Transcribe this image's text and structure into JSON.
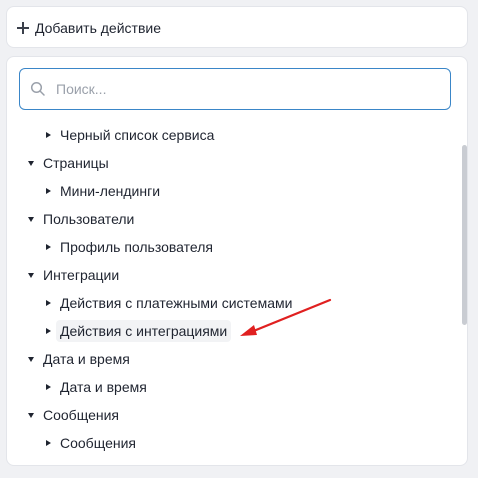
{
  "add_action": {
    "label": "Добавить действие"
  },
  "search": {
    "placeholder": "Поиск..."
  },
  "tree": [
    {
      "kind": "child",
      "label": "Черный список сервиса"
    },
    {
      "kind": "group",
      "label": "Страницы"
    },
    {
      "kind": "child",
      "label": "Мини-лендинги"
    },
    {
      "kind": "group",
      "label": "Пользователи"
    },
    {
      "kind": "child",
      "label": "Профиль пользователя"
    },
    {
      "kind": "group",
      "label": "Интеграции"
    },
    {
      "kind": "child",
      "label": "Действия с платежными системами"
    },
    {
      "kind": "child",
      "label": "Действия с интеграциями",
      "highlight": true
    },
    {
      "kind": "group",
      "label": "Дата и время"
    },
    {
      "kind": "child",
      "label": "Дата и время"
    },
    {
      "kind": "group",
      "label": "Сообщения"
    },
    {
      "kind": "child",
      "label": "Сообщения"
    }
  ],
  "colors": {
    "accent": "#3a86c8",
    "annotation_arrow": "#e02020",
    "background": "#f0f1f4"
  },
  "icons": {
    "add": "plus-icon",
    "search": "search-icon",
    "expanded": "caret-down-icon",
    "collapsed": "caret-right-icon"
  }
}
